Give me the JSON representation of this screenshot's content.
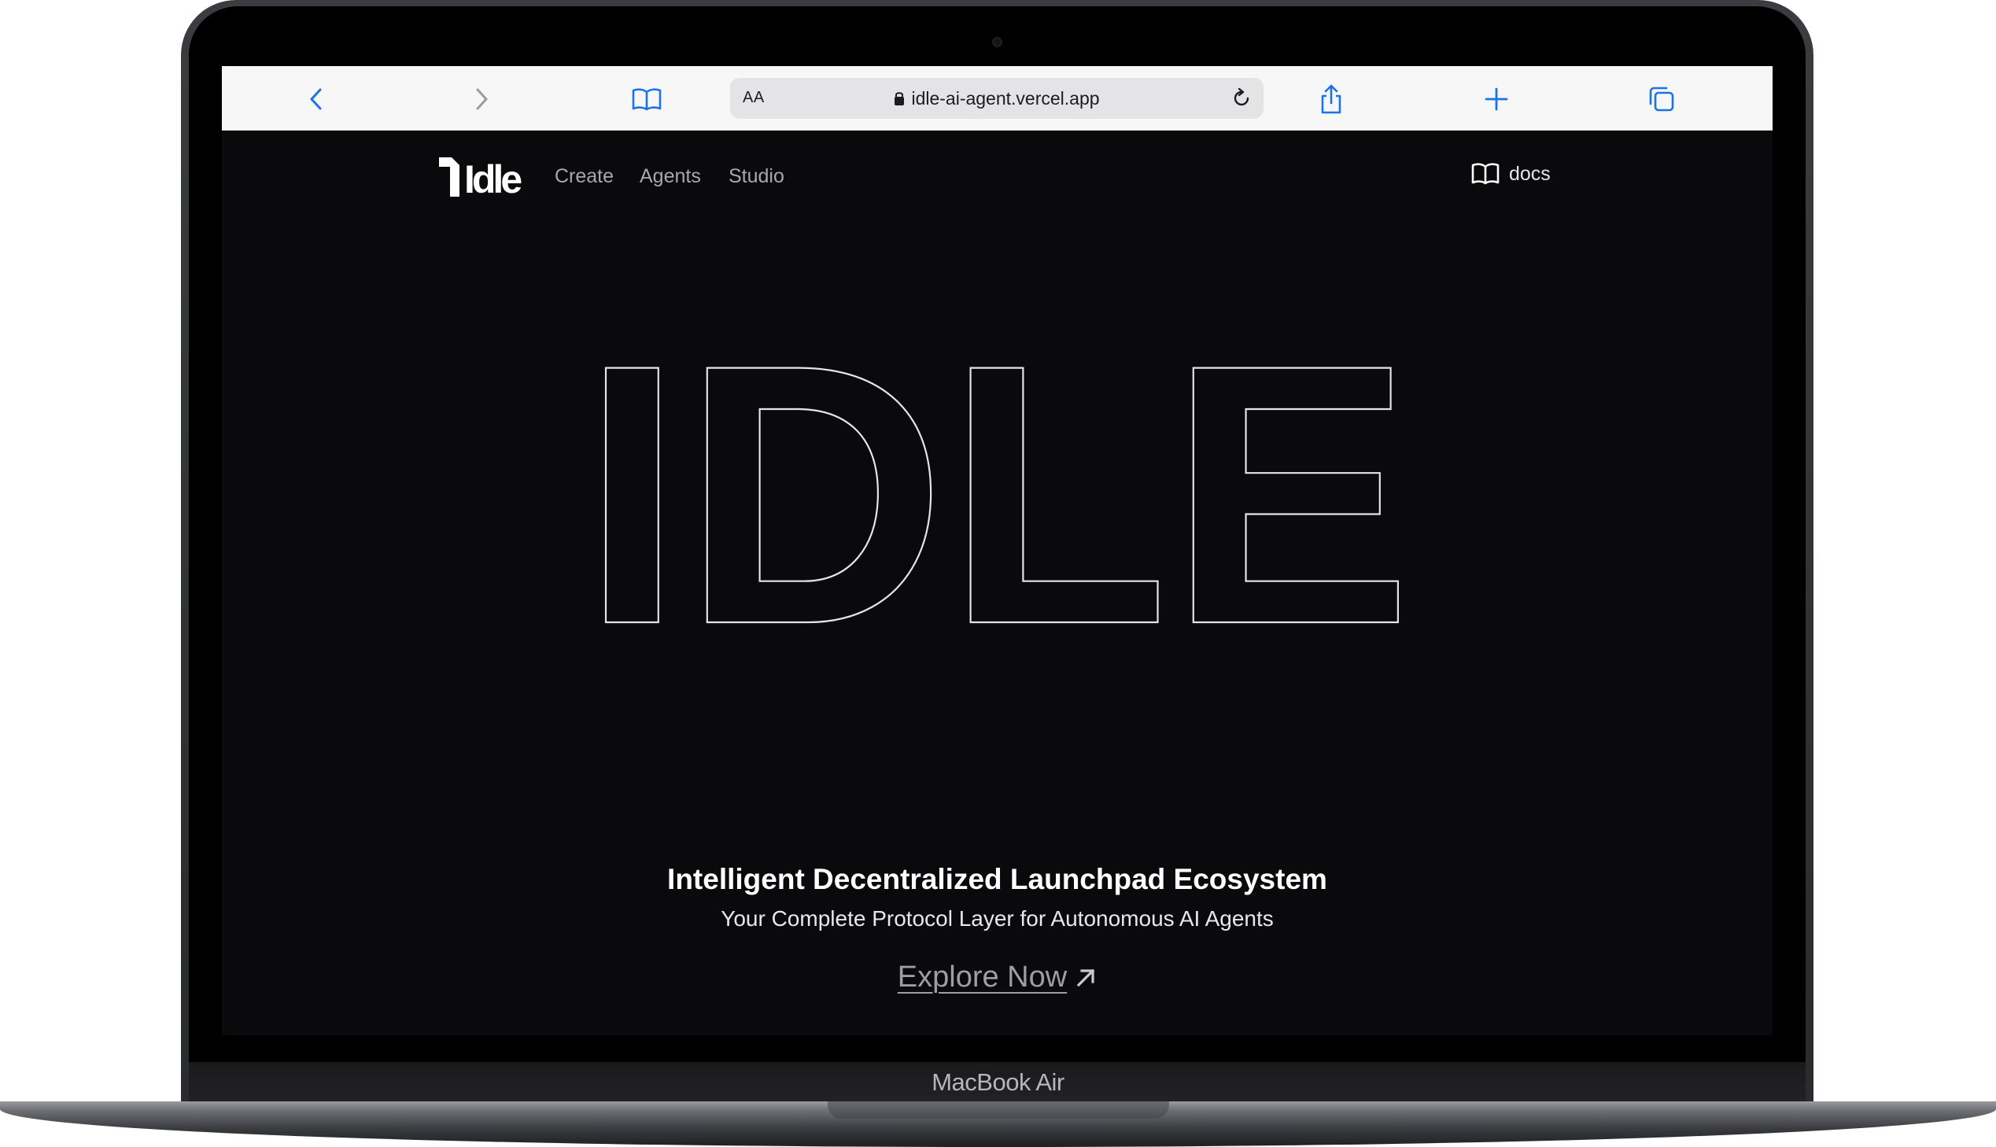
{
  "device": {
    "label": "MacBook Air"
  },
  "browser": {
    "address": {
      "aa_label": "AA",
      "url": "idle-ai-agent.vercel.app"
    },
    "icons": {
      "back": "chevron-left-icon",
      "forward": "chevron-right-icon",
      "bookmarks": "book-icon",
      "lock": "lock-icon",
      "reload": "reload-icon",
      "share": "share-icon",
      "new_tab": "plus-icon",
      "tabs": "tabs-icon"
    },
    "accent_color": "#1a73e8"
  },
  "site": {
    "logo_text": "Idle",
    "nav": {
      "create": "Create",
      "agents": "Agents",
      "studio": "Studio"
    },
    "docs_label": "docs",
    "hero": {
      "outline_word": "IDLE",
      "title": "Intelligent Decentralized Launchpad Ecosystem",
      "subtitle": "Your Complete Protocol Layer for Autonomous AI Agents",
      "cta": "Explore Now"
    },
    "colors": {
      "background": "#0a0a0c",
      "text": "#ffffff",
      "muted": "#a7a7ad"
    }
  }
}
